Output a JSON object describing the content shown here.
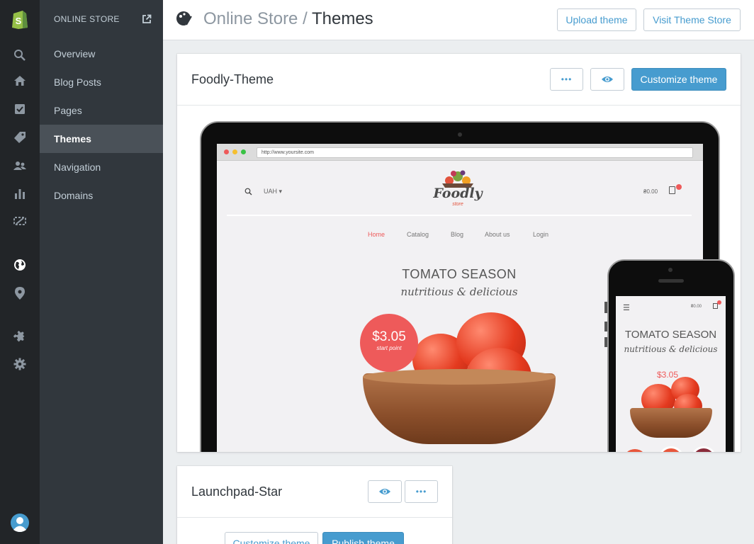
{
  "sidebar": {
    "section_title": "ONLINE STORE",
    "items": [
      {
        "label": "Overview"
      },
      {
        "label": "Blog Posts"
      },
      {
        "label": "Pages"
      },
      {
        "label": "Themes"
      },
      {
        "label": "Navigation"
      },
      {
        "label": "Domains"
      }
    ]
  },
  "rail_icons": [
    "shopify-logo-icon",
    "search-icon",
    "home-icon",
    "orders-icon",
    "products-tag-icon",
    "customers-icon",
    "reports-icon",
    "discounts-icon",
    "online-store-globe-icon",
    "location-pin-icon",
    "apps-puzzle-icon",
    "settings-gear-icon",
    "user-avatar-icon"
  ],
  "header": {
    "crumb": "Online Store",
    "separator": " / ",
    "page": "Themes",
    "upload_label": "Upload theme",
    "visit_label": "Visit Theme Store"
  },
  "current_theme": {
    "name": "Foodly-Theme",
    "more_label": "•••",
    "customize_label": "Customize theme",
    "preview": {
      "url": "http://www.yoursite.com",
      "currency": "UAH",
      "cart_total": "₴0.00",
      "brand": "Foodly",
      "brand_sub": "store",
      "menu": [
        "Home",
        "Catalog",
        "Blog",
        "About us",
        "Login"
      ],
      "headline": "TOMATO SEASON",
      "subheadline": "nutritious & delicious",
      "price": "$3.05",
      "price_note": "start point"
    }
  },
  "other_theme": {
    "name": "Launchpad-Star",
    "more_label": "•••",
    "customize_label": "Customize theme",
    "publish_label": "Publish theme"
  },
  "colors": {
    "accent": "#479ccf",
    "rail": "#222528",
    "sidebar": "#31373d",
    "brand_green": "#95bf47",
    "price_red": "#ee5a5a"
  }
}
